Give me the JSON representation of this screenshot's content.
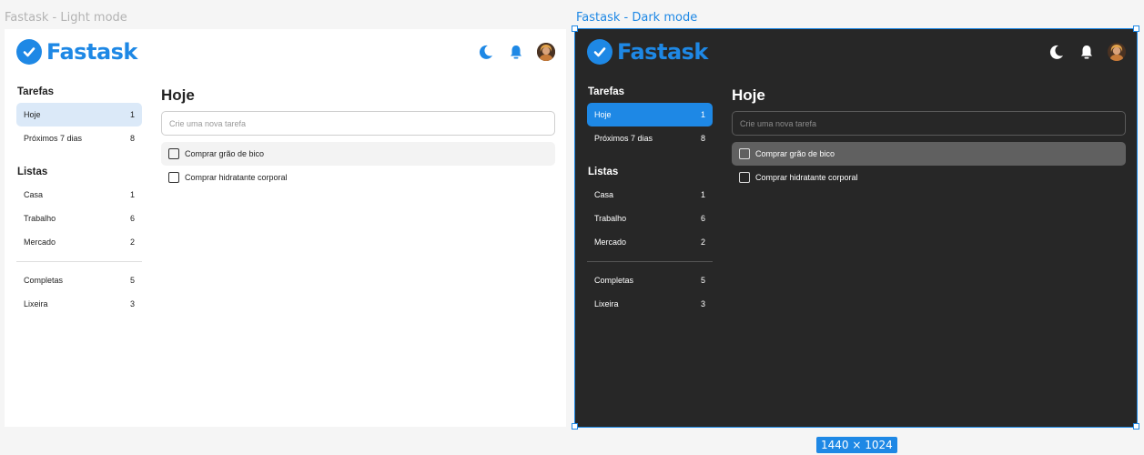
{
  "canvas": {
    "light_label": "Fastask - Light mode",
    "dark_label": "Fastask - Dark mode",
    "size_badge": "1440 × 1024"
  },
  "app": {
    "name": "Fastask",
    "header_icons": [
      "moon-icon",
      "bell-icon",
      "avatar"
    ]
  },
  "sidebar": {
    "tasks_title": "Tarefas",
    "tasks": [
      {
        "label": "Hoje",
        "count": "1"
      },
      {
        "label": "Próximos 7 dias",
        "count": "8"
      }
    ],
    "lists_title": "Listas",
    "lists": [
      {
        "label": "Casa",
        "count": "1"
      },
      {
        "label": "Trabalho",
        "count": "6"
      },
      {
        "label": "Mercado",
        "count": "2"
      }
    ],
    "extra": [
      {
        "label": "Completas",
        "count": "5"
      },
      {
        "label": "Lixeira",
        "count": "3"
      }
    ]
  },
  "main": {
    "title": "Hoje",
    "input_placeholder": "Crie uma nova tarefa",
    "tasks": [
      {
        "label": "Comprar grão de bico"
      },
      {
        "label": "Comprar hidratante corporal"
      }
    ]
  },
  "colors": {
    "accent": "#1e88e5",
    "dark_bg": "#272727",
    "light_bg": "#ffffff"
  }
}
